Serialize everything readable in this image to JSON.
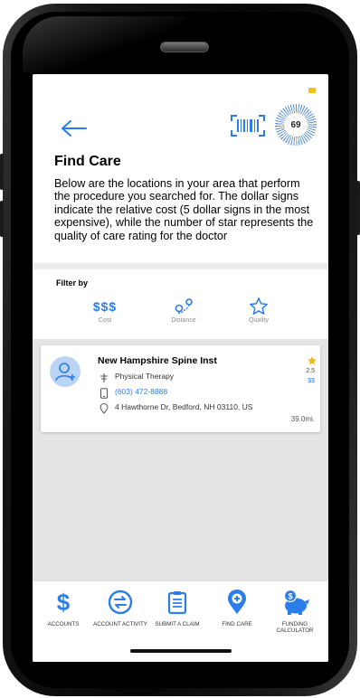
{
  "header": {
    "back_icon": "arrow-left-icon",
    "barcode_icon": "barcode-icon",
    "score": "69",
    "title": "Find Care",
    "description": "Below are the locations in your area that perform the procedure you searched for. The dollar signs indicate the relative cost (5 dollar signs in the most expensive), while the number of star represents the quality of care rating for the doctor"
  },
  "filter": {
    "title": "Filter by",
    "items": [
      {
        "icon": "$$$",
        "label": "Cost"
      },
      {
        "icon": "location-pins-icon",
        "label": "Distance"
      },
      {
        "icon": "star-outline-icon",
        "label": "Quality"
      }
    ]
  },
  "results": [
    {
      "name": "New Hampshire Spine Inst",
      "specialty": "Physical Therapy",
      "phone": "(603) 472-8888",
      "address": "4 Hawthorne Dr, Bedford, NH 03110, US",
      "rating": "2.5",
      "cost": "$$",
      "distance": "39.0mi."
    }
  ],
  "tabbar": [
    {
      "icon": "dollar-icon",
      "label": "Accounts"
    },
    {
      "icon": "transfer-icon",
      "label": "Account Activity"
    },
    {
      "icon": "clipboard-icon",
      "label": "Submit A Claim"
    },
    {
      "icon": "location-plus-icon",
      "label": "Find Care"
    },
    {
      "icon": "piggy-bank-icon",
      "label": "Funding Calculator"
    }
  ],
  "colors": {
    "accent": "#2b7de9",
    "star": "#f2b620",
    "list_background": "#e4e4e4"
  }
}
